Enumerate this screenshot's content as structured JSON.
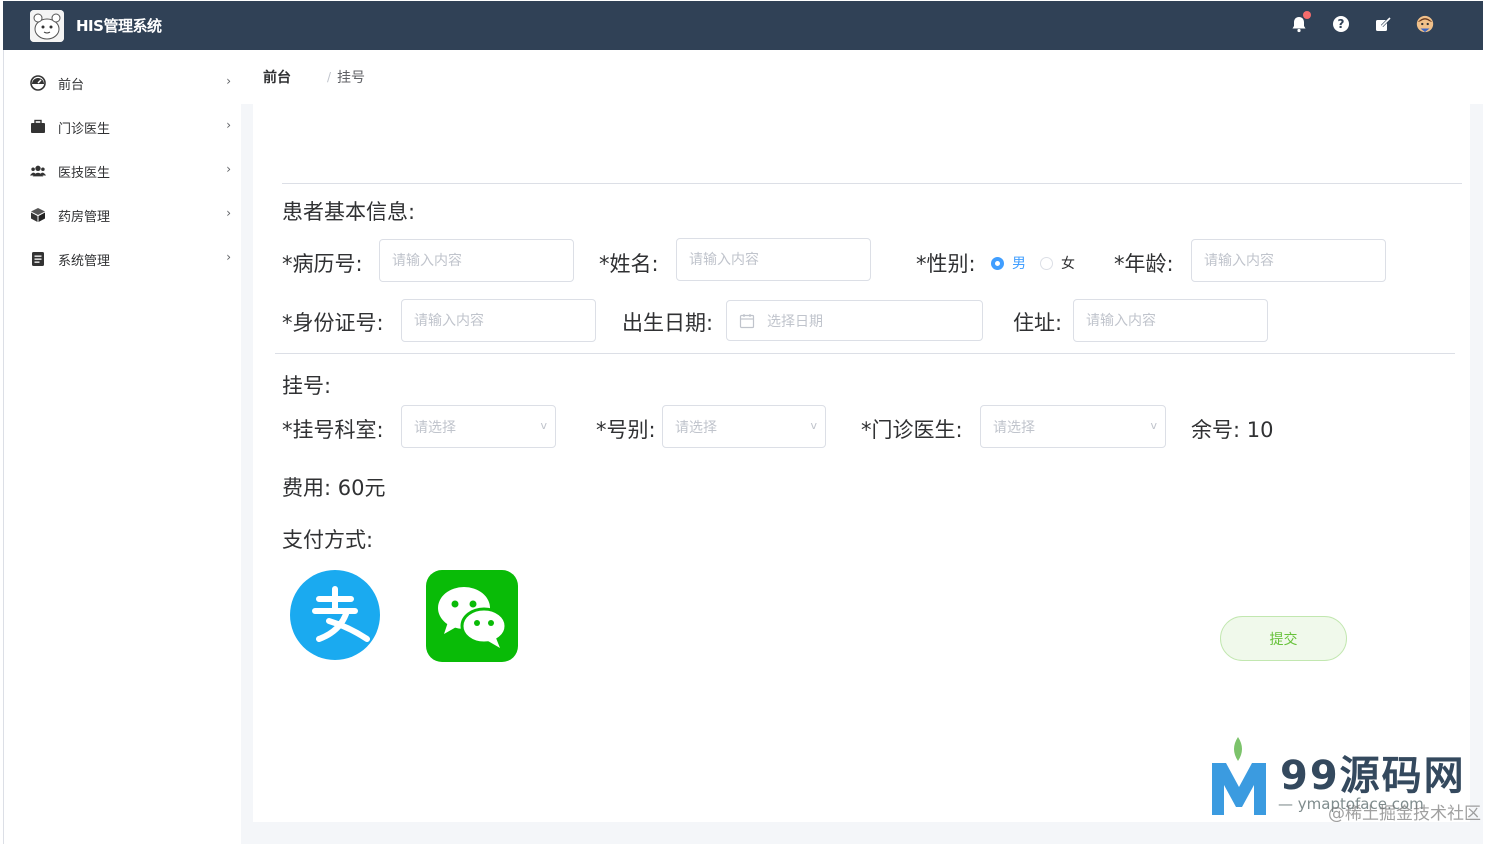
{
  "header": {
    "title": "HIS管理系统",
    "icons": [
      "bell-icon",
      "help-icon",
      "edit-icon",
      "avatar-icon"
    ],
    "colors": {
      "bg": "#304156",
      "badge": "#f56c6c"
    }
  },
  "sidebar": {
    "items": [
      {
        "label": "前台",
        "icon": "dashboard-icon"
      },
      {
        "label": "门诊医生",
        "icon": "briefcase-icon"
      },
      {
        "label": "医技医生",
        "icon": "users-icon"
      },
      {
        "label": "药房管理",
        "icon": "cube-icon"
      },
      {
        "label": "系统管理",
        "icon": "document-icon"
      }
    ],
    "arrow": "›"
  },
  "breadcrumb": {
    "first": "前台",
    "sep": "/",
    "second": "挂号"
  },
  "patient": {
    "title": "患者基本信息:",
    "record_no_label": "*病历号:",
    "record_no_placeholder": "请输入内容",
    "name_label": "*姓名:",
    "name_placeholder": "请输入内容",
    "gender_label": "*性别:",
    "gender_male": "男",
    "gender_female": "女",
    "gender_selected": "男",
    "age_label": "*年龄:",
    "age_placeholder": "请输入内容",
    "id_label": "*身份证号:",
    "id_placeholder": "请输入内容",
    "birth_label": "出生日期:",
    "birth_placeholder": "选择日期",
    "address_label": "住址:",
    "address_placeholder": "请输入内容"
  },
  "register": {
    "title": "挂号:",
    "dept_label": "*挂号科室:",
    "dept_placeholder": "请选择",
    "type_label": "*号别:",
    "type_placeholder": "请选择",
    "doctor_label": "*门诊医生:",
    "doctor_placeholder": "请选择",
    "remaining": "余号:  10",
    "fee": "费用:  60元",
    "payment_label": "支付方式:",
    "payment_methods": [
      "alipay-icon",
      "wechat-pay-icon"
    ],
    "submit_label": "提交"
  },
  "watermark": {
    "brand": "99源码网",
    "url": "— ymaptoface.com",
    "overlay": "@稀土掘金技术社区"
  },
  "colors": {
    "primary": "#409eff",
    "success": "#67c23a",
    "alipay": "#1aaaf0",
    "wechat": "#09bb07"
  }
}
